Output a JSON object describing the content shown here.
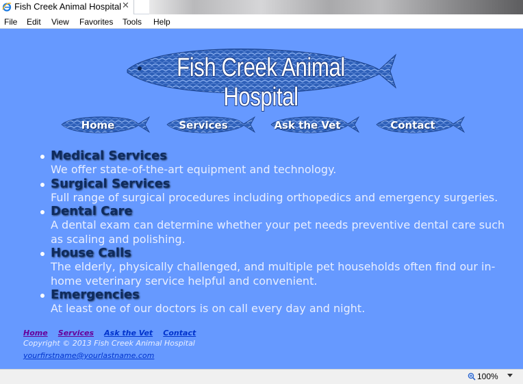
{
  "browser": {
    "tab_title": "Fish Creek Animal Hospital",
    "close_glyph": "✕",
    "menu": [
      "File",
      "Edit",
      "View",
      "Favorites",
      "Tools",
      "Help"
    ],
    "zoom": "100%"
  },
  "page": {
    "logo_text": "Fish Creek Animal Hospital",
    "nav": [
      "Home",
      "Services",
      "Ask the Vet",
      "Contact"
    ],
    "services": [
      {
        "title": "Medical Services",
        "desc": "We offer state-of-the-art equipment and technology."
      },
      {
        "title": "Surgical Services",
        "desc": "Full range of surgical procedures including orthopedics and emergency surgeries."
      },
      {
        "title": "Dental Care",
        "desc": "A dental exam can determine whether your pet needs preventive dental care such as scaling and polishing."
      },
      {
        "title": "House Calls",
        "desc": "The elderly, physically challenged, and multiple pet households often find our in-home veterinary service helpful and convenient."
      },
      {
        "title": "Emergencies",
        "desc": "At least one of our doctors is on call every day and night."
      }
    ],
    "footer": {
      "links": [
        {
          "label": "Home",
          "color": "#660099"
        },
        {
          "label": "Services",
          "color": "#660099"
        },
        {
          "label": "Ask the Vet",
          "color": "#0033cc"
        },
        {
          "label": "Contact",
          "color": "#0033cc"
        }
      ],
      "copyright": "Copyright © 2013 Fish Creek Animal Hospital",
      "email": "yourfirstname@yourlastname.com"
    }
  },
  "colors": {
    "page_bg": "#6699ff",
    "heading": "#0e2b5e",
    "fish_dark": "#1f4fa3",
    "fish_light": "#7fa8ef"
  }
}
